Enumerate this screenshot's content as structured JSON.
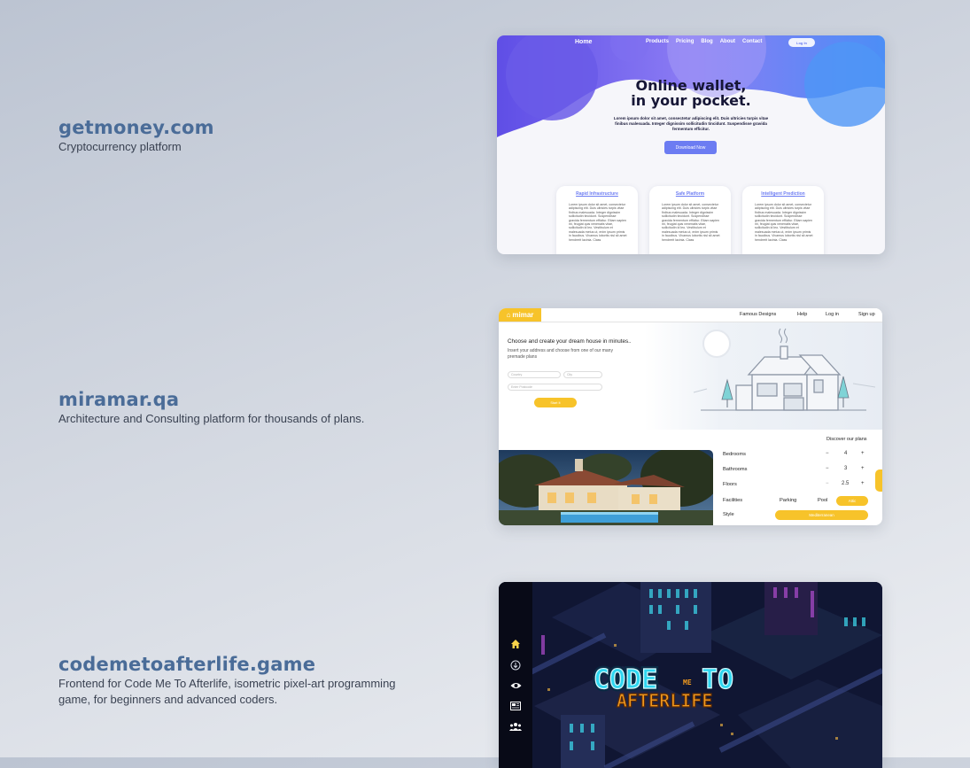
{
  "projects": [
    {
      "title": "getmoney.com",
      "description": "Cryptocurrency platform",
      "preview": {
        "nav_home": "Home",
        "nav_links": [
          "Products",
          "Pricing",
          "Blog",
          "About",
          "Contact"
        ],
        "login_button": "Log In",
        "headline_line1": "Online wallet,",
        "headline_line2": "in your pocket.",
        "subtext": "Lorem ipsum dolor sit amet, consectetur adipiscing elit. Duis ultricies turpis vitae finibus malesuada. Integer dignissim sollicitudin tincidunt. Suspendisse gravida fermentum efficitur.",
        "download_button": "Download Now",
        "cards": [
          {
            "title": "Rapid Infrastructure",
            "text": "Lorem ipsum dolor sit amet, consectetur adipiscing elit. Duis ultricies turpis vitae finibus malesuada. Integer dignissim sollicitudin tincidunt. Suspendisse gravida fermentum efficitur. Etiam sapien mi, feugiat quis venenatis vitae, sollicitudin id leo. Vestibulum et malesuada metus ut, enim ipsum primis in faucibus. Vivamus lobortis nisl sit amet hendrerit lacinia. Class"
          },
          {
            "title": "Safe Platform",
            "text": "Lorem ipsum dolor sit amet, consectetur adipiscing elit. Duis ultricies turpis vitae finibus malesuada. Integer dignissim sollicitudin tincidunt. Suspendisse gravida fermentum efficitur. Etiam sapien mi, feugiat quis venenatis vitae, sollicitudin id leo. Vestibulum et malesuada metus ut, enim ipsum primis in faucibus. Vivamus lobortis nisl sit amet hendrerit lacinia. Class"
          },
          {
            "title": "Intelligent Prediction",
            "text": "Lorem ipsum dolor sit amet, consectetur adipiscing elit. Duis ultricies turpis vitae finibus malesuada. Integer dignissim sollicitudin tincidunt. Suspendisse gravida fermentum efficitur. Etiam sapien mi, feugiat quis venenatis vitae, sollicitudin id leo. Vestibulum et malesuada metus ut, enim ipsum primis in faucibus. Vivamus lobortis nisl sit amet hendrerit lacinia. Class"
          }
        ]
      }
    },
    {
      "title": "miramar.qa",
      "description": "Architecture and Consulting platform for thousands of plans.",
      "preview": {
        "logo": "mimar",
        "nav_links": [
          "Famous Designs",
          "Help",
          "Log in",
          "Sign up"
        ],
        "hero_title": "Choose and create your dream house in minutes..",
        "hero_sub": "Insert your address and choose from one of our many premade plans",
        "country_placeholder": "Country",
        "city_placeholder": "City",
        "postcode_placeholder": "Enter Postcode",
        "go_button": "Start It",
        "discover": "Discover our plans",
        "rows": [
          {
            "label": "Bedrooms",
            "value": "4"
          },
          {
            "label": "Bathrooms",
            "value": "3"
          },
          {
            "label": "Floors",
            "value": "2.5"
          }
        ],
        "facilities_label": "Facilities",
        "facilities": [
          "Parking",
          "Pool",
          "Attic"
        ],
        "style_label": "Style",
        "style_value": "Mediterranean"
      }
    },
    {
      "title": "codemetoafterlife.game",
      "description": "Frontend for Code Me To Afterlife, isometric pixel-art programming game, for beginners and advanced coders.",
      "preview": {
        "logo_line1": "CODE",
        "logo_me": "ME",
        "logo_to": "TO",
        "logo_line2": "AFTERLIFE"
      }
    }
  ],
  "colors": {
    "title": "#4a6c98",
    "getmoney_accent": "#6c7cf2",
    "miramar_accent": "#f7c32a",
    "game_logo_cyan": "#2fd6f0",
    "game_logo_orange": "#f29a1e"
  }
}
